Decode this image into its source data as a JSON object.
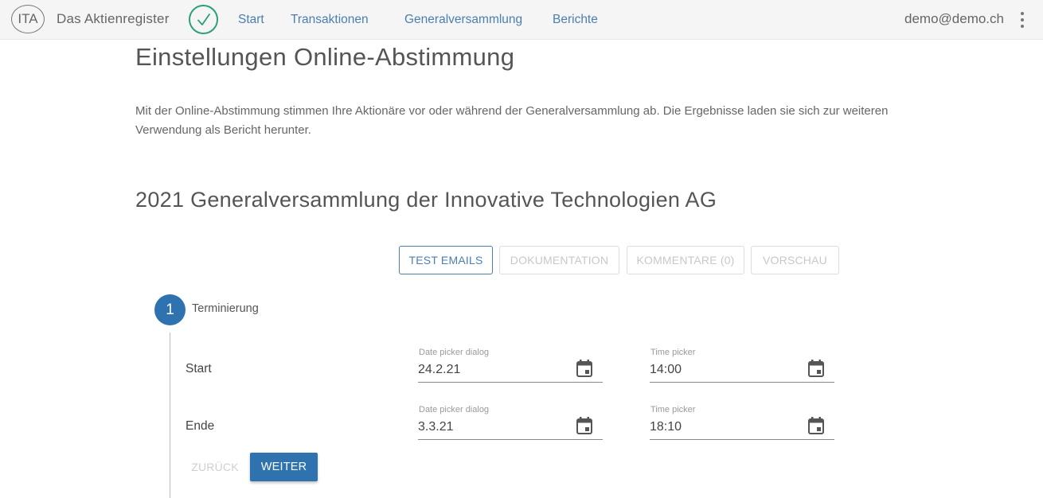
{
  "header": {
    "logo_text": "ITA",
    "app_title": "Das Aktienregister",
    "status_icon": "check-icon",
    "nav": [
      {
        "label": "Start"
      },
      {
        "label": "Transaktionen"
      },
      {
        "label": "Generalversammlung"
      },
      {
        "label": "Berichte"
      }
    ],
    "user_email": "demo@demo.ch",
    "menu_icon": "kebab-menu-icon"
  },
  "page": {
    "title": "Einstellungen Online-Abstimmung",
    "intro": "Mit der Online-Abstimmung stimmen Ihre Aktionäre vor oder während der Generalversammlung ab. Die Ergebnisse laden sie sich zur weiteren Verwendung als Bericht herunter.",
    "section_title": "2021 Generalversammlung der Innovative Technologien AG"
  },
  "actions": {
    "test_emails": "TEST EMAILS",
    "documentation": "DOKUMENTATION",
    "comments": "KOMMENTARE (0)",
    "preview": "VORSCHAU"
  },
  "stepper": {
    "step_number": "1",
    "step_label": "Terminierung",
    "rows": [
      {
        "label": "Start",
        "date_caption": "Date picker dialog",
        "date_value": "24.2.21",
        "time_caption": "Time picker",
        "time_value": "14:00"
      },
      {
        "label": "Ende",
        "date_caption": "Date picker dialog",
        "date_value": "3.3.21",
        "time_caption": "Time picker",
        "time_value": "18:10"
      }
    ],
    "back_label": "ZURÜCK",
    "next_label": "WEITER"
  },
  "colors": {
    "accent_blue": "#2e73b0",
    "link_blue": "#4a7fb0",
    "check_green": "#2aa07a"
  }
}
